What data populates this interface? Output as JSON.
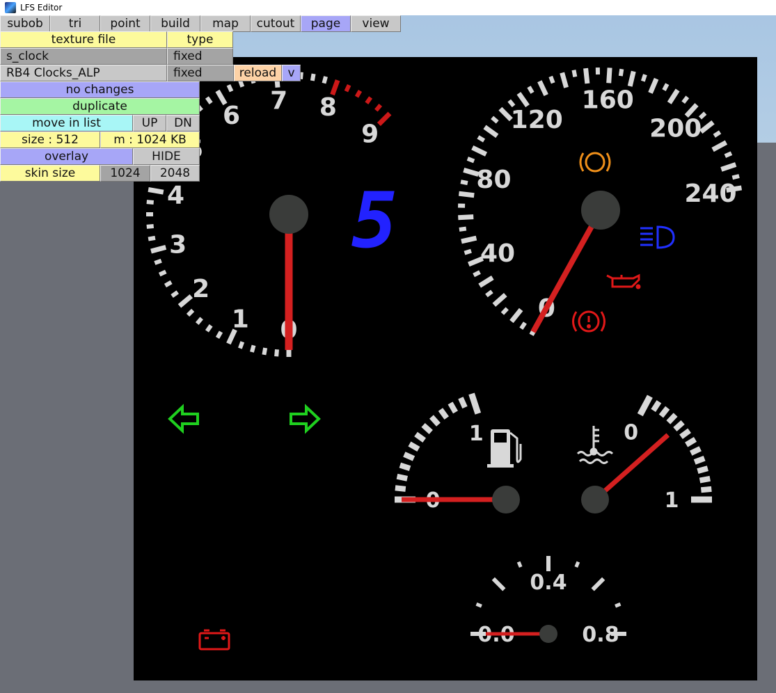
{
  "window": {
    "title": "LFS Editor"
  },
  "tabs": [
    {
      "label": "subob"
    },
    {
      "label": "tri"
    },
    {
      "label": "point"
    },
    {
      "label": "build"
    },
    {
      "label": "map"
    },
    {
      "label": "cutout"
    },
    {
      "label": "page",
      "active": true
    },
    {
      "label": "view"
    }
  ],
  "panel": {
    "texture_file_header": "texture file",
    "type_header": "type",
    "rows": [
      {
        "name": "s_clock",
        "type": "fixed"
      },
      {
        "name": "RB4 Clocks_ALP",
        "type": "fixed"
      }
    ],
    "reload": "reload",
    "dropdown": "v",
    "status": "no changes",
    "duplicate": "duplicate",
    "move_in_list": "move in list",
    "up": "UP",
    "dn": "DN",
    "size": "size : 512",
    "memory": "m : 1024 KB",
    "overlay": "overlay",
    "hide": "HIDE",
    "skin_size": "skin size",
    "skin_1024": "1024",
    "skin_2048": "2048"
  },
  "colors": {
    "accent_tab": "#a7a6f7",
    "needle": "#d42020",
    "gear": "#2222ff",
    "warning_red": "#e01818",
    "abs_orange": "#f0901a",
    "arrow_green": "#1fd01f",
    "headlight_blue": "#2030ff"
  },
  "gauges": {
    "tachometer": {
      "labels": [
        "0",
        "1",
        "2",
        "3",
        "4",
        "5",
        "6",
        "7",
        "8",
        "9"
      ],
      "redline_from": 8,
      "needle_value": 0
    },
    "speedometer": {
      "labels": [
        "0",
        "40",
        "80",
        "120",
        "160",
        "200",
        "240"
      ],
      "needle_value": 0
    },
    "fuel": {
      "labels": [
        "0",
        "1"
      ],
      "needle_value": 0,
      "icon": "fuel-pump-icon"
    },
    "coolant": {
      "labels": [
        "0",
        "1"
      ],
      "needle_value": 0.33,
      "icon": "coolant-temperature-icon"
    },
    "boost": {
      "labels": [
        "0.0",
        "0.4",
        "0.8"
      ],
      "needle_value": 0
    }
  },
  "gear": "5",
  "indicators": [
    "abs-icon",
    "headlight-icon",
    "oil-pressure-icon",
    "brake-warning-icon",
    "left-turn-arrow-icon",
    "right-turn-arrow-icon",
    "battery-icon"
  ]
}
